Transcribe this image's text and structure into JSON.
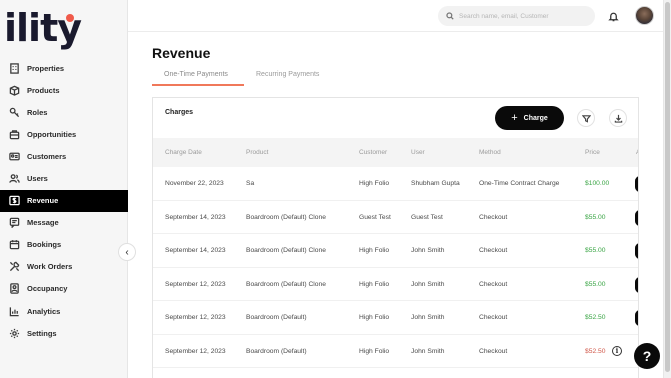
{
  "brand": {
    "logo_text": "ility",
    "accent": "#f05a4a"
  },
  "sidebar": {
    "items": [
      {
        "label": "Properties",
        "icon": "building-icon",
        "active": false
      },
      {
        "label": "Products",
        "icon": "box-icon",
        "active": false
      },
      {
        "label": "Roles",
        "icon": "key-icon",
        "active": false
      },
      {
        "label": "Opportunities",
        "icon": "briefcase-icon",
        "active": false
      },
      {
        "label": "Customers",
        "icon": "id-card-icon",
        "active": false
      },
      {
        "label": "Users",
        "icon": "users-icon",
        "active": false
      },
      {
        "label": "Revenue",
        "icon": "dollar-icon",
        "active": true
      },
      {
        "label": "Message",
        "icon": "message-icon",
        "active": false
      },
      {
        "label": "Bookings",
        "icon": "calendar-icon",
        "active": false
      },
      {
        "label": "Work Orders",
        "icon": "tools-icon",
        "active": false
      },
      {
        "label": "Occupancy",
        "icon": "occupancy-icon",
        "active": false
      },
      {
        "label": "Analytics",
        "icon": "chart-icon",
        "active": false
      },
      {
        "label": "Settings",
        "icon": "gear-icon",
        "active": false
      }
    ],
    "collapse_icon": "‹"
  },
  "topbar": {
    "search_placeholder": "Search name, email, Customer"
  },
  "main": {
    "title": "Revenue",
    "tabs": [
      {
        "label": "One-Time Payments",
        "active": true
      },
      {
        "label": "Recurring Payments",
        "active": false
      }
    ],
    "card": {
      "title": "Charges",
      "charge_button": "Charge",
      "columns": [
        "Charge Date",
        "Product",
        "Customer",
        "User",
        "Method",
        "Price",
        "A"
      ],
      "rows": [
        {
          "date": "November 22, 2023",
          "product": "Sa",
          "customer": "High Folio",
          "user": "Shubham Gupta",
          "method": "One-Time Contract Charge",
          "price": "$100.00",
          "price_status": "green"
        },
        {
          "date": "September 14, 2023",
          "product": "Boardroom (Default) Clone",
          "customer": "Guest Test",
          "user": "Guest Test",
          "method": "Checkout",
          "price": "$55.00",
          "price_status": "green"
        },
        {
          "date": "September 14, 2023",
          "product": "Boardroom (Default) Clone",
          "customer": "High Folio",
          "user": "John Smith",
          "method": "Checkout",
          "price": "$55.00",
          "price_status": "green"
        },
        {
          "date": "September 12, 2023",
          "product": "Boardroom (Default) Clone",
          "customer": "High Folio",
          "user": "John Smith",
          "method": "Checkout",
          "price": "$55.00",
          "price_status": "green"
        },
        {
          "date": "September 12, 2023",
          "product": "Boardroom (Default)",
          "customer": "High Folio",
          "user": "John Smith",
          "method": "Checkout",
          "price": "$52.50",
          "price_status": "green"
        },
        {
          "date": "September 12, 2023",
          "product": "Boardroom (Default)",
          "customer": "High Folio",
          "user": "John Smith",
          "method": "Checkout",
          "price": "$52.50",
          "price_status": "red"
        }
      ]
    }
  },
  "help": {
    "label": "?"
  },
  "colors": {
    "green": "#3aa545",
    "red": "#d0584a",
    "tab_underline": "#f0785a"
  }
}
